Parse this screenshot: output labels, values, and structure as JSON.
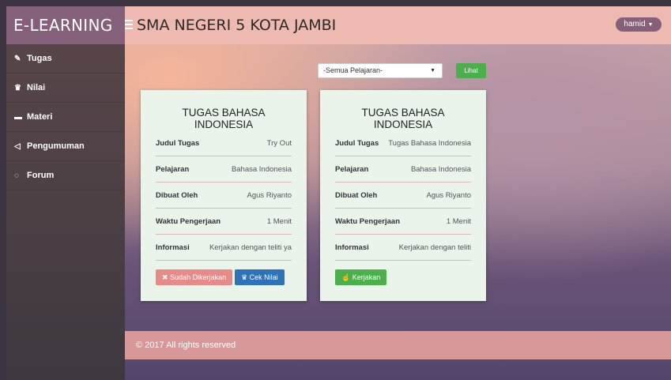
{
  "header": {
    "brand": "E-LEARNING",
    "school": "SMA NEGERI 5 KOTA JAMBI",
    "user": "hamid"
  },
  "sidebar": {
    "items": [
      {
        "label": "Tugas",
        "icon": "pencil-icon"
      },
      {
        "label": "Nilai",
        "icon": "trophy-icon"
      },
      {
        "label": "Materi",
        "icon": "book-icon"
      },
      {
        "label": "Pengumuman",
        "icon": "bullhorn-icon"
      },
      {
        "label": "Forum",
        "icon": "comments-icon"
      }
    ]
  },
  "filter": {
    "selected": "-Semua Pelajaran-",
    "button": "Lihat"
  },
  "cards": [
    {
      "title": "TUGAS BAHASA INDONESIA",
      "rows": [
        {
          "label": "Judul Tugas",
          "value": "Try Out"
        },
        {
          "label": "Pelajaran",
          "value": "Bahasa Indonesia"
        },
        {
          "label": "Dibuat Oleh",
          "value": "Agus Riyanto"
        },
        {
          "label": "Waktu Pengerjaan",
          "value": "1 Menit"
        },
        {
          "label": "Informasi",
          "value": "Kerjakan dengan teliti ya"
        }
      ],
      "buttons": [
        "Sudah Dikerjakan",
        "Cek Nilai"
      ]
    },
    {
      "title": "TUGAS BAHASA INDONESIA",
      "rows": [
        {
          "label": "Judul Tugas",
          "value": "Tugas Bahasa Indonesia"
        },
        {
          "label": "Pelajaran",
          "value": "Bahasa Indonesia"
        },
        {
          "label": "Dibuat Oleh",
          "value": "Agus Riyanto"
        },
        {
          "label": "Waktu Pengerjaan",
          "value": "1 Menit"
        },
        {
          "label": "Informasi",
          "value": "Kerjakan dengan teliti"
        }
      ],
      "buttons": [
        "Kerjakan"
      ]
    }
  ],
  "footer": "© 2017 All rights reserved",
  "colors": {
    "brand": "#85607a",
    "header": "#eeb9b1",
    "green": "#4cae4c",
    "blue": "#2f72b7",
    "red": "#e68a8a"
  }
}
